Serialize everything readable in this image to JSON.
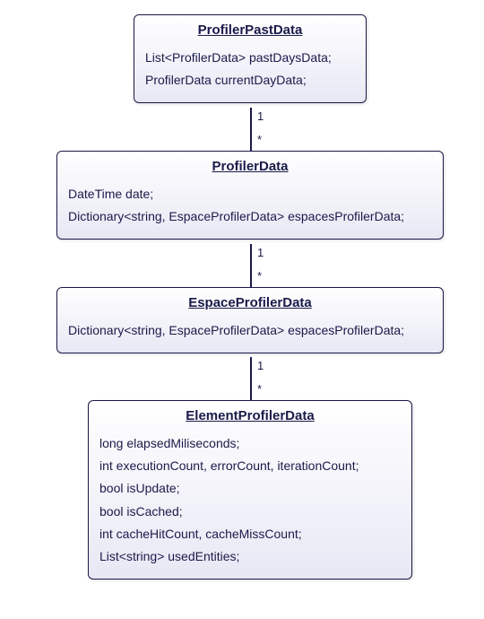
{
  "classes": {
    "c1": {
      "name": "ProfilerPastData",
      "attrs": [
        "List<ProfilerData> pastDaysData;",
        "ProfilerData currentDayData;"
      ]
    },
    "c2": {
      "name": "ProfilerData",
      "attrs": [
        "DateTime date;",
        "Dictionary<string, EspaceProfilerData> espacesProfilerData;"
      ]
    },
    "c3": {
      "name": "EspaceProfilerData",
      "attrs": [
        "Dictionary<string, EspaceProfilerData> espacesProfilerData;"
      ]
    },
    "c4": {
      "name": "ElementProfilerData",
      "attrs": [
        "long elapsedMiliseconds;",
        "int executionCount, errorCount, iterationCount;",
        "bool isUpdate;",
        "bool isCached;",
        "int cacheHitCount, cacheMissCount;",
        "List<string> usedEntities;"
      ]
    }
  },
  "mult": {
    "m1top": "1",
    "m1bot": "*",
    "m2top": "1",
    "m2bot": "*",
    "m3top": "1",
    "m3bot": "*"
  }
}
